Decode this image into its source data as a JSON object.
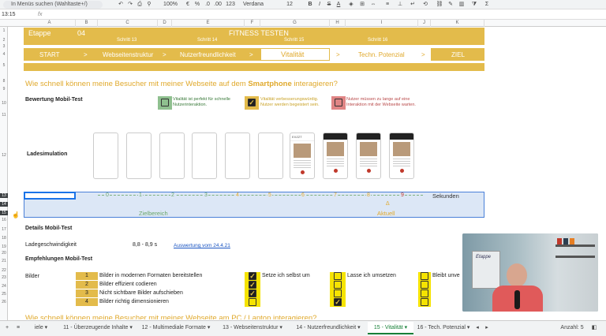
{
  "toolbar": {
    "search": "In Menüs suchen (Wahltaste+/)",
    "zoom": "100%",
    "currency": "€",
    "percent": "%",
    "dec_less": ".0",
    "dec_more": ".00",
    "format_123": "123",
    "font": "Verdana",
    "font_size": "12",
    "bold": "B",
    "italic": "I",
    "strike": "S",
    "textcolor": "A",
    "sigma": "Σ"
  },
  "cell_ref": "13:15",
  "fx": "fx",
  "columns": [
    "A",
    "B",
    "C",
    "D",
    "E",
    "F",
    "G",
    "H",
    "I",
    "J",
    "K"
  ],
  "rows": [
    "1",
    "2",
    "3",
    "4",
    "5",
    "8",
    "9",
    "10",
    "11",
    "12",
    "13",
    "14",
    "15",
    "16",
    "17",
    "18",
    "19",
    "20",
    "21",
    "22",
    "23",
    "24",
    "25",
    "26"
  ],
  "header": {
    "etappe_label": "Etappe",
    "etappe_num": "04",
    "title": "FITNESS TESTEN",
    "steps": [
      "Schritt 13",
      "Schritt 14",
      "Schritt 15",
      "Schritt 16"
    ],
    "nav": [
      "START",
      ">",
      "Webseitenstruktur",
      ">",
      "Nutzerfreundlichkeit",
      ">",
      "Vitalität",
      ">",
      "Techn. Potenzial",
      ">",
      "ZIEL"
    ]
  },
  "question": {
    "pre": "Wie schnell können meine Besucher mit meiner Webseite auf dem ",
    "bold": "Smartphone",
    "post": " interagieren?"
  },
  "mobile_test": {
    "title": "Bewertung Mobil-Test",
    "legend": [
      {
        "text": "Vitalität ist perfekt für schnelle Nutzerinteraktion.",
        "color": "#8fc08f"
      },
      {
        "text": "Vitalität verbesserungswürdig. Nutzer werden begeistert sein.",
        "color": "#e3bb4b"
      },
      {
        "text": "Nutzer müssen zu lange auf eine Interaktion mit der Webseite warten.",
        "color": "#e08585"
      }
    ]
  },
  "load": {
    "label": "Ladesimulation",
    "phone_badge": "EXZZT"
  },
  "scale": {
    "ticks": [
      "0",
      "1",
      "2",
      "3",
      "4",
      "5",
      "6",
      "7",
      "8",
      "9"
    ],
    "unit": "Sekunden",
    "target": "Zielbereich",
    "current_marker": "Δ",
    "current": "Aktuell"
  },
  "details": {
    "title": "Details Mobil-Test",
    "speed_label": "Ladegeschwindigkeit",
    "speed_value": "8,8 - 8,9 s",
    "link": "Auswertung vom 24.4.21"
  },
  "recommend": {
    "title": "Empfehlungen Mobil-Test",
    "images_label": "Bilder",
    "items": [
      {
        "num": "1",
        "text": "Bilder in modernen Formaten bereitstellen",
        "c1": true,
        "c2": false,
        "c3": false
      },
      {
        "num": "2",
        "text": "Bilder effizient codieren",
        "c1": true,
        "c2": false,
        "c3": false
      },
      {
        "num": "3",
        "text": "Nicht sichtbare Bilder aufschieben",
        "c1": true,
        "c2": false,
        "c3": false
      },
      {
        "num": "4",
        "text": "Bilder richtig dimensionieren",
        "c1": false,
        "c2": true,
        "c3": false
      }
    ],
    "col1": "Setze ich selbst um",
    "col2": "Lasse ich umsetzen",
    "col3": "Bleibt unve",
    "cutoff": "Wie schnell können meine Besucher mit meiner Webseite am PC / Laptop interagieren?"
  },
  "tabs": [
    "iele",
    "11 - Überzeugende Inhalte",
    "12 - Multimediale Formate",
    "13 - Webseitenstruktur",
    "14 - Nutzerfreundlichkeit",
    "15 - Vitalität",
    "16 - Tech. Potenzial"
  ],
  "status": "Anzahl: 5",
  "video": {
    "poster_text": "Etappe"
  }
}
